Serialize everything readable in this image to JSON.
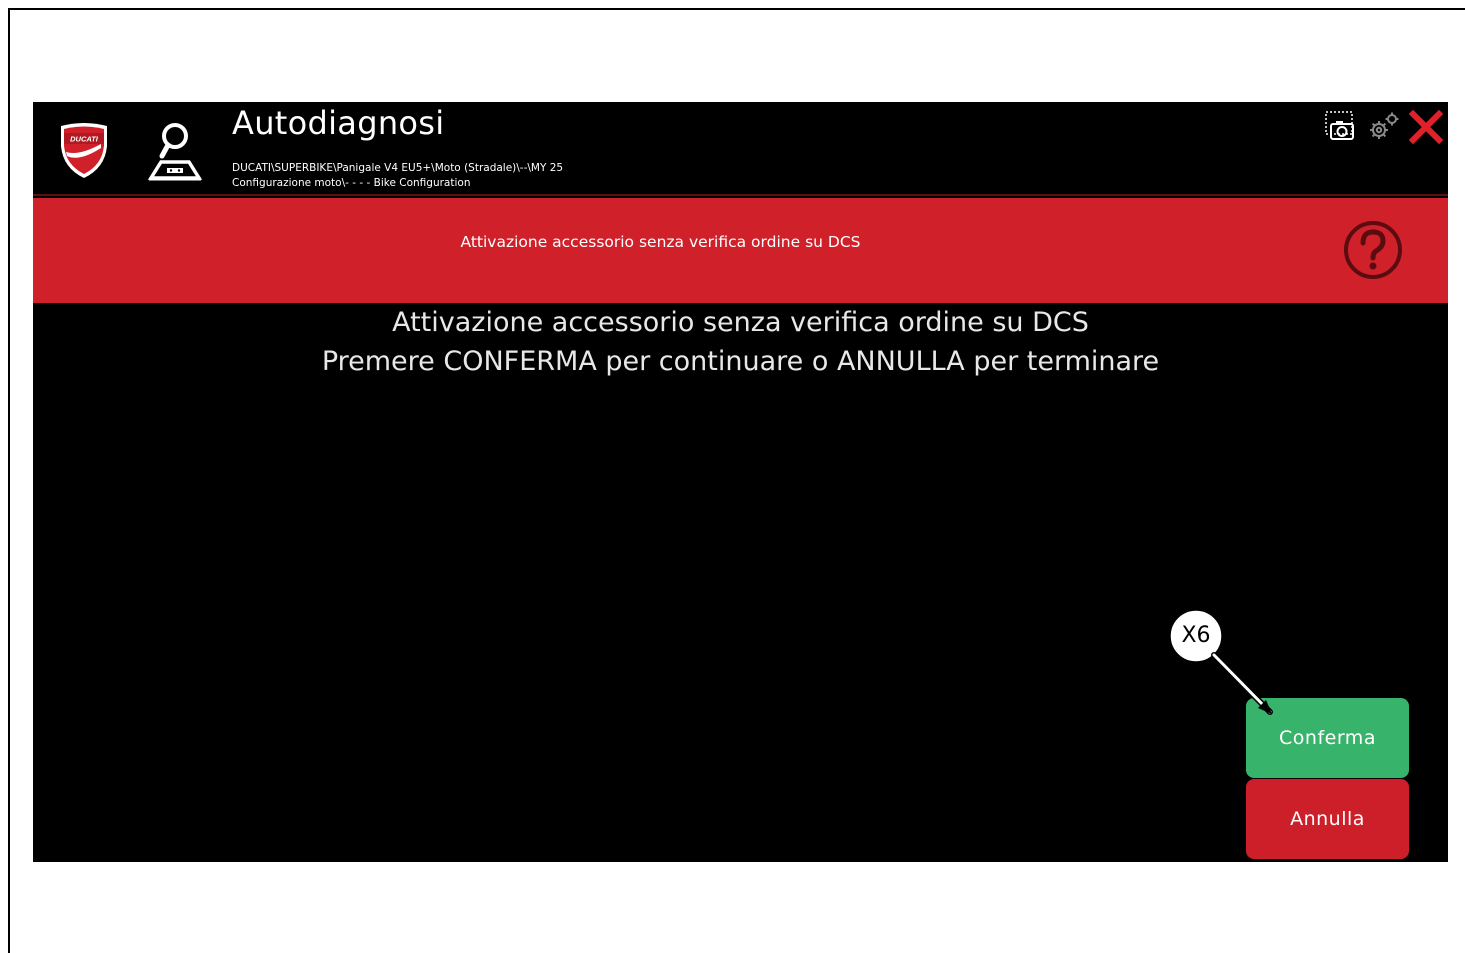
{
  "app": {
    "title": "Autodiagnosi",
    "path_line1": "DUCATI\\SUPERBIKE\\Panigale V4 EU5+\\Moto (Stradale)\\--\\MY 25",
    "path_line2": "Configurazione moto\\- - - - Bike Configuration",
    "logo_text": "DUCATI"
  },
  "toolbar": {
    "screenshot_icon": "screenshot-icon",
    "settings_icon": "gear-icon",
    "close_icon": "close-icon"
  },
  "banner": {
    "text": "Attivazione accessorio senza verifica ordine su DCS",
    "help_icon": "help-icon"
  },
  "message": {
    "line1": "Attivazione accessorio senza verifica ordine su DCS",
    "line2": "Premere CONFERMA per continuare o ANNULLA per terminare"
  },
  "buttons": {
    "confirm_label": "Conferma",
    "cancel_label": "Annulla"
  },
  "callout": {
    "label": "X6"
  },
  "colors": {
    "banner": "#d0202a",
    "confirm": "#38b36b",
    "cancel": "#cc1f29",
    "background": "#000000"
  }
}
